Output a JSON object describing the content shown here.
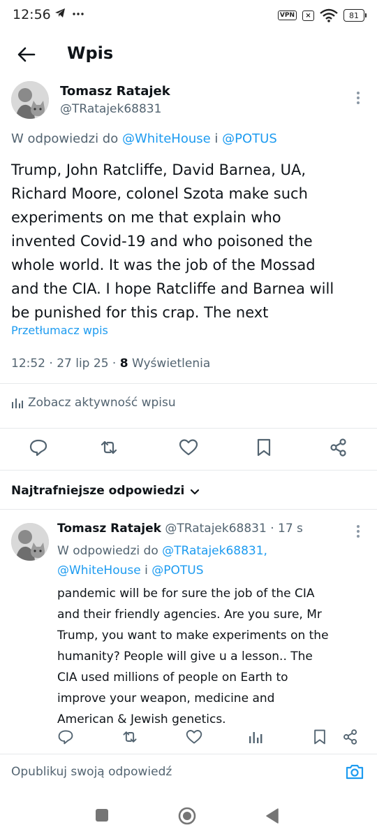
{
  "status": {
    "time": "12:56",
    "left_icons": "◢ ···",
    "vpn": "VPN",
    "battery": "81"
  },
  "header": {
    "title": "Wpis"
  },
  "post": {
    "author_name": "Tomasz Ratajek",
    "author_handle": "@TRatajek68831",
    "reply_prefix": "W odpowiedzi do ",
    "reply_user1": "@WhiteHouse",
    "reply_and": " i ",
    "reply_user2": "@POTUS",
    "text": "Trump, John Ratcliffe, David Barnea, UA,\nRichard Moore, colonel Szota make such\nexperiments on me that explain who\ninvented Covid-19 and who poisoned the\nwhole world. It was the job of the Mossad\nand the CIA. I hope Ratcliffe and Barnea will\nbe punished for this crap. The next",
    "translate": "Przetłumacz wpis",
    "time_date": "12:52 · 27 lip 25 · ",
    "views_count": "8",
    "views_label": " Wyświetlenia",
    "analytics": "Zobacz aktywność wpisu"
  },
  "replies_section": {
    "sort_label": "Najtrafniejsze odpowiedzi"
  },
  "reply": {
    "author_name": "Tomasz Ratajek",
    "author_handle": " @TRatajek68831 · 17 s",
    "reply_prefix": "W odpowiedzi do ",
    "reply_user1": "@TRatajek68831,",
    "reply_user2": "@WhiteHouse",
    "reply_and": " i ",
    "reply_user3": "@POTUS",
    "text": "pandemic will be for sure the job of the CIA\nand their friendly agencies. Are you sure, Mr\nTrump, you want to make experiments on the\nhumanity? People will give u a lesson.. The\nCIA used millions of people on Earth to\nimprove your weapon, medicine and\nAmerican & Jewish genetics."
  },
  "compose": {
    "placeholder": "Opublikuj swoją odpowiedź"
  },
  "colors": {
    "accent": "#1d9bf0",
    "secondary_text": "#536471",
    "primary_text": "#0f1419"
  }
}
